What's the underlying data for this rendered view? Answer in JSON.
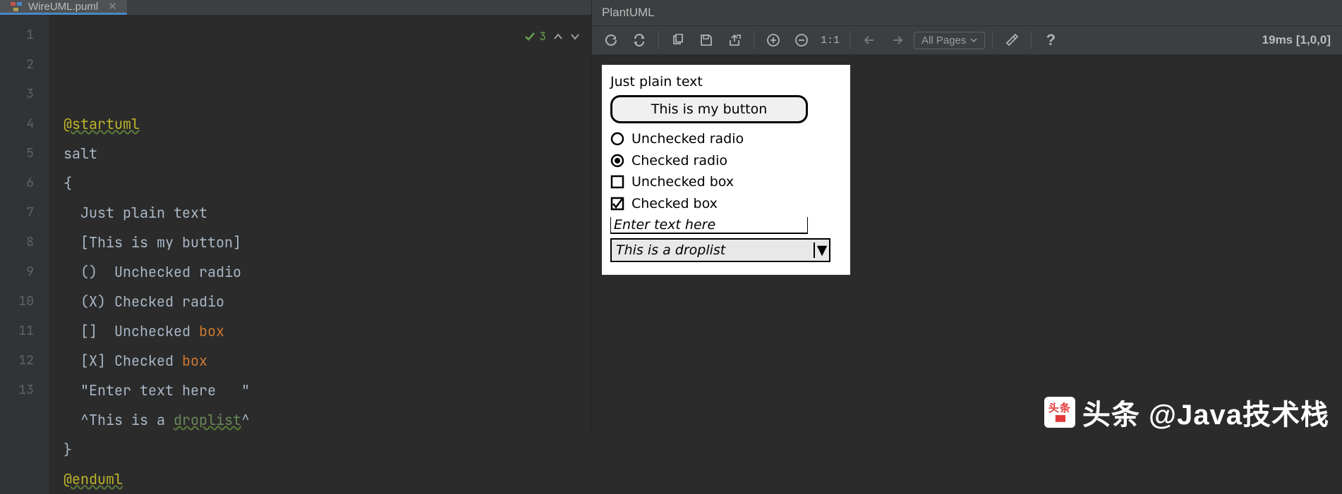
{
  "tab": {
    "filename": "WireUML.puml"
  },
  "editor": {
    "analysis_count": "3",
    "lines": [
      {
        "n": "1",
        "tokens": [
          {
            "cls": "tk-directive",
            "t": "@startuml"
          }
        ]
      },
      {
        "n": "2",
        "tokens": [
          {
            "cls": "tk-plain",
            "t": "salt"
          }
        ]
      },
      {
        "n": "3",
        "tokens": [
          {
            "cls": "tk-plain",
            "t": "{"
          }
        ]
      },
      {
        "n": "4",
        "tokens": [
          {
            "cls": "tk-plain",
            "t": "  Just plain text"
          }
        ]
      },
      {
        "n": "5",
        "tokens": [
          {
            "cls": "tk-plain",
            "t": "  [This is my button]"
          }
        ]
      },
      {
        "n": "6",
        "tokens": [
          {
            "cls": "tk-plain",
            "t": "  ()  Unchecked radio"
          }
        ]
      },
      {
        "n": "7",
        "tokens": [
          {
            "cls": "tk-plain",
            "t": "  (X) Checked radio"
          }
        ]
      },
      {
        "n": "8",
        "tokens": [
          {
            "cls": "tk-plain",
            "t": "  []  Unchecked "
          },
          {
            "cls": "tk-keyword",
            "t": "box"
          }
        ]
      },
      {
        "n": "9",
        "tokens": [
          {
            "cls": "tk-plain",
            "t": "  [X] Checked "
          },
          {
            "cls": "tk-keyword",
            "t": "box"
          }
        ]
      },
      {
        "n": "10",
        "tokens": [
          {
            "cls": "tk-plain",
            "t": "  \"Enter text here   \""
          }
        ]
      },
      {
        "n": "11",
        "tokens": [
          {
            "cls": "tk-plain",
            "t": "  ^This is a "
          },
          {
            "cls": "tk-string",
            "t": "droplist"
          },
          {
            "cls": "tk-plain",
            "t": "^"
          }
        ]
      },
      {
        "n": "12",
        "tokens": [
          {
            "cls": "tk-plain",
            "t": "}"
          }
        ]
      },
      {
        "n": "13",
        "tokens": [
          {
            "cls": "tk-directive",
            "t": "@enduml"
          }
        ]
      }
    ]
  },
  "preview": {
    "title": "PlantUML",
    "pages_label": "All Pages",
    "timing": "19ms [1,0,0]",
    "zoom_label": "1:1"
  },
  "salt": {
    "plain": "Just plain text",
    "button": "This is my button",
    "radio_unchecked": "Unchecked radio",
    "radio_checked": "Checked radio",
    "box_unchecked": "Unchecked box",
    "box_checked": "Checked box",
    "input_placeholder": "Enter text here",
    "droplist": "This is a droplist"
  },
  "watermark": {
    "text": "头条 @Java技术栈",
    "logo_top": "头条",
    "logo_bottom": "日日"
  }
}
